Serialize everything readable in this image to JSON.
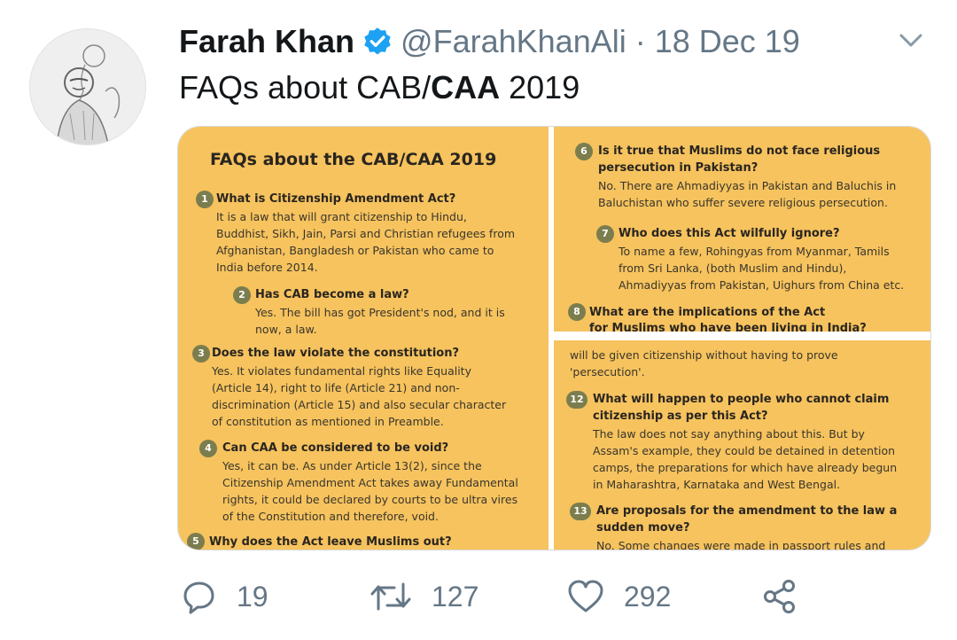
{
  "tweet": {
    "author_name": "Farah Khan",
    "handle": "@FarahKhanAli",
    "separator": "·",
    "date": "18 Dec 19",
    "text_prefix": "FAQs about CAB/",
    "text_bold": "CAA",
    "text_suffix": " 2019"
  },
  "image": {
    "title": "FAQs about the CAB/CAA 2019",
    "left": [
      {
        "num": "1",
        "q": [
          "What is Citizenship Amendment Act?"
        ],
        "a": [
          "It is a law that will grant citizenship to Hindu,",
          "Buddhist, Sikh, Jain, Parsi and Christian refugees from",
          "Afghanistan, Bangladesh or Pakistan who came to",
          "India before 2014."
        ]
      },
      {
        "num": "2",
        "q": [
          "Has CAB become a law?"
        ],
        "a": [
          "Yes. The bill has got President's nod, and it is",
          "now, a law."
        ]
      },
      {
        "num": "3",
        "q": [
          "Does the law violate the constitution?"
        ],
        "a": [
          "Yes. It violates fundamental rights like Equality",
          "(Article 14), right to life (Article 21) and non-",
          "discrimination (Article 15) and also secular character",
          "of constitution as mentioned in Preamble."
        ]
      },
      {
        "num": "4",
        "q": [
          "Can CAA be considered to be void?"
        ],
        "a": [
          "Yes, it can be. As under Article 13(2), since the",
          "Citizenship Amendment Act takes away Fundamental",
          "rights, it could be declared by courts to be ultra vires",
          "of the Constitution and therefore, void."
        ]
      },
      {
        "num": "5",
        "q": [
          "Why does the Act leave Muslims out?"
        ],
        "a": []
      }
    ],
    "right_top": [
      {
        "num": "6",
        "q": [
          "Is it true that Muslims do not face religious",
          "persecution in Pakistan?"
        ],
        "a": [
          "No. There are Ahmadiyyas in Pakistan and Baluchis in",
          "Baluchistan who suffer severe religious persecution."
        ]
      },
      {
        "num": "7",
        "q": [
          "Who does this Act wilfully ignore?"
        ],
        "a": [
          "To name a few, Rohingyas from Myanmar, Tamils",
          "from Sri Lanka, (both Muslim and Hindu),",
          "Ahmadiyyas from Pakistan, Uighurs from China etc."
        ]
      },
      {
        "num": "8",
        "q": [
          "What are the implications of the Act",
          "for Muslims who have been living in India?"
        ],
        "a": []
      }
    ],
    "right_bottom": {
      "lead": [
        "will be given citizenship without having to prove",
        "'persecution'."
      ],
      "items": [
        {
          "num": "12",
          "q": [
            "What will happen to people who cannot claim",
            "citizenship as per this Act?"
          ],
          "a": [
            "The law does not say anything about this. But by",
            "Assam's example, they could be detained in detention",
            "camps, the preparations for which have already begun",
            "in Maharashtra, Karnataka and West Bengal."
          ]
        },
        {
          "num": "13",
          "q": [
            "Are proposals for the amendment to the law a",
            "sudden move?"
          ],
          "a": [
            "No. Some changes were made in passport rules and"
          ]
        }
      ]
    }
  },
  "actions": {
    "reply_count": "19",
    "retweet_count": "127",
    "like_count": "292"
  },
  "icons": {
    "verified": "verified-badge-icon",
    "menu": "chevron-down-icon",
    "reply": "reply-icon",
    "retweet": "retweet-icon",
    "like": "heart-icon",
    "share": "share-icon"
  },
  "colors": {
    "verified_blue": "#1da1f2",
    "muted_gray": "#657786",
    "panel_yellow": "#f6c35e",
    "number_badge": "#7b7d4e"
  }
}
